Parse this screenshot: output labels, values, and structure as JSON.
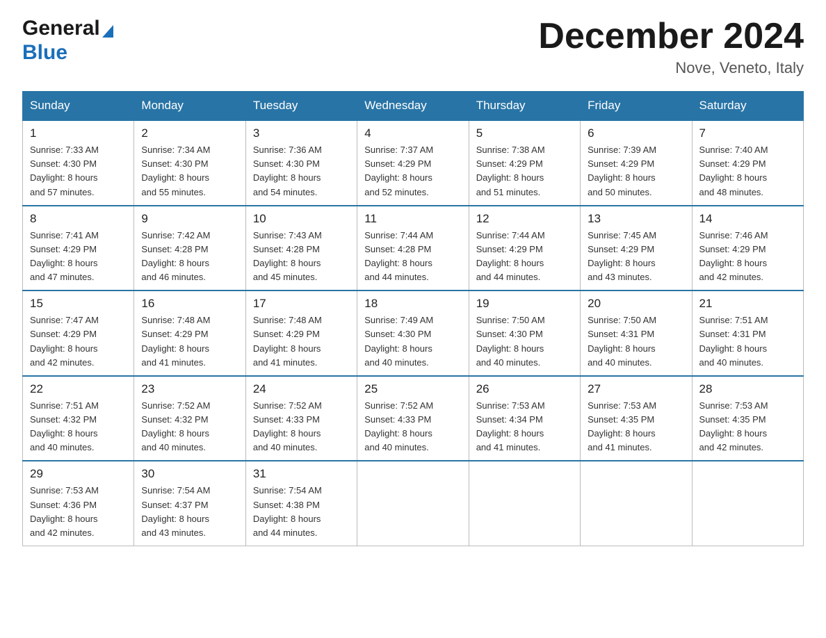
{
  "header": {
    "logo_general": "General",
    "logo_blue": "Blue",
    "month_title": "December 2024",
    "location": "Nove, Veneto, Italy"
  },
  "days_of_week": [
    "Sunday",
    "Monday",
    "Tuesday",
    "Wednesday",
    "Thursday",
    "Friday",
    "Saturday"
  ],
  "weeks": [
    [
      {
        "day": "1",
        "sunrise": "7:33 AM",
        "sunset": "4:30 PM",
        "daylight": "8 hours and 57 minutes."
      },
      {
        "day": "2",
        "sunrise": "7:34 AM",
        "sunset": "4:30 PM",
        "daylight": "8 hours and 55 minutes."
      },
      {
        "day": "3",
        "sunrise": "7:36 AM",
        "sunset": "4:30 PM",
        "daylight": "8 hours and 54 minutes."
      },
      {
        "day": "4",
        "sunrise": "7:37 AM",
        "sunset": "4:29 PM",
        "daylight": "8 hours and 52 minutes."
      },
      {
        "day": "5",
        "sunrise": "7:38 AM",
        "sunset": "4:29 PM",
        "daylight": "8 hours and 51 minutes."
      },
      {
        "day": "6",
        "sunrise": "7:39 AM",
        "sunset": "4:29 PM",
        "daylight": "8 hours and 50 minutes."
      },
      {
        "day": "7",
        "sunrise": "7:40 AM",
        "sunset": "4:29 PM",
        "daylight": "8 hours and 48 minutes."
      }
    ],
    [
      {
        "day": "8",
        "sunrise": "7:41 AM",
        "sunset": "4:29 PM",
        "daylight": "8 hours and 47 minutes."
      },
      {
        "day": "9",
        "sunrise": "7:42 AM",
        "sunset": "4:28 PM",
        "daylight": "8 hours and 46 minutes."
      },
      {
        "day": "10",
        "sunrise": "7:43 AM",
        "sunset": "4:28 PM",
        "daylight": "8 hours and 45 minutes."
      },
      {
        "day": "11",
        "sunrise": "7:44 AM",
        "sunset": "4:28 PM",
        "daylight": "8 hours and 44 minutes."
      },
      {
        "day": "12",
        "sunrise": "7:44 AM",
        "sunset": "4:29 PM",
        "daylight": "8 hours and 44 minutes."
      },
      {
        "day": "13",
        "sunrise": "7:45 AM",
        "sunset": "4:29 PM",
        "daylight": "8 hours and 43 minutes."
      },
      {
        "day": "14",
        "sunrise": "7:46 AM",
        "sunset": "4:29 PM",
        "daylight": "8 hours and 42 minutes."
      }
    ],
    [
      {
        "day": "15",
        "sunrise": "7:47 AM",
        "sunset": "4:29 PM",
        "daylight": "8 hours and 42 minutes."
      },
      {
        "day": "16",
        "sunrise": "7:48 AM",
        "sunset": "4:29 PM",
        "daylight": "8 hours and 41 minutes."
      },
      {
        "day": "17",
        "sunrise": "7:48 AM",
        "sunset": "4:29 PM",
        "daylight": "8 hours and 41 minutes."
      },
      {
        "day": "18",
        "sunrise": "7:49 AM",
        "sunset": "4:30 PM",
        "daylight": "8 hours and 40 minutes."
      },
      {
        "day": "19",
        "sunrise": "7:50 AM",
        "sunset": "4:30 PM",
        "daylight": "8 hours and 40 minutes."
      },
      {
        "day": "20",
        "sunrise": "7:50 AM",
        "sunset": "4:31 PM",
        "daylight": "8 hours and 40 minutes."
      },
      {
        "day": "21",
        "sunrise": "7:51 AM",
        "sunset": "4:31 PM",
        "daylight": "8 hours and 40 minutes."
      }
    ],
    [
      {
        "day": "22",
        "sunrise": "7:51 AM",
        "sunset": "4:32 PM",
        "daylight": "8 hours and 40 minutes."
      },
      {
        "day": "23",
        "sunrise": "7:52 AM",
        "sunset": "4:32 PM",
        "daylight": "8 hours and 40 minutes."
      },
      {
        "day": "24",
        "sunrise": "7:52 AM",
        "sunset": "4:33 PM",
        "daylight": "8 hours and 40 minutes."
      },
      {
        "day": "25",
        "sunrise": "7:52 AM",
        "sunset": "4:33 PM",
        "daylight": "8 hours and 40 minutes."
      },
      {
        "day": "26",
        "sunrise": "7:53 AM",
        "sunset": "4:34 PM",
        "daylight": "8 hours and 41 minutes."
      },
      {
        "day": "27",
        "sunrise": "7:53 AM",
        "sunset": "4:35 PM",
        "daylight": "8 hours and 41 minutes."
      },
      {
        "day": "28",
        "sunrise": "7:53 AM",
        "sunset": "4:35 PM",
        "daylight": "8 hours and 42 minutes."
      }
    ],
    [
      {
        "day": "29",
        "sunrise": "7:53 AM",
        "sunset": "4:36 PM",
        "daylight": "8 hours and 42 minutes."
      },
      {
        "day": "30",
        "sunrise": "7:54 AM",
        "sunset": "4:37 PM",
        "daylight": "8 hours and 43 minutes."
      },
      {
        "day": "31",
        "sunrise": "7:54 AM",
        "sunset": "4:38 PM",
        "daylight": "8 hours and 44 minutes."
      },
      null,
      null,
      null,
      null
    ]
  ],
  "labels": {
    "sunrise": "Sunrise:",
    "sunset": "Sunset:",
    "daylight": "Daylight:"
  }
}
